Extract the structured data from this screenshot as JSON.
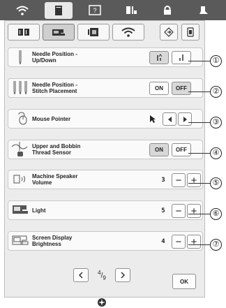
{
  "top_tabs": [
    {
      "name": "wifi-icon",
      "active": false
    },
    {
      "name": "page-icon",
      "active": true
    },
    {
      "name": "help-icon",
      "active": false
    },
    {
      "name": "stitch-icon",
      "active": false
    },
    {
      "name": "lock-icon",
      "active": false
    },
    {
      "name": "presser-foot-icon",
      "active": false
    }
  ],
  "sub_tabs": [
    {
      "name": "sewing-settings-icon",
      "active": false
    },
    {
      "name": "machine-settings-icon",
      "active": true
    },
    {
      "name": "embroidery-settings-icon",
      "active": false
    },
    {
      "name": "wireless-icon",
      "active": false
    }
  ],
  "rows": [
    {
      "label": "Needle Position -\nUp/Down",
      "icon": "needle-icon",
      "callout": "①"
    },
    {
      "label": "Needle Position -\nStitch Placement",
      "icon": "needles-icon",
      "on": "ON",
      "off": "OFF",
      "callout": "②"
    },
    {
      "label": "Mouse Pointer",
      "icon": "mouse-icon",
      "callout": "③"
    },
    {
      "label": "Upper and Bobbin\nThread Sensor",
      "icon": "thread-sensor-icon",
      "on": "ON",
      "off": "OFF",
      "callout": "④"
    },
    {
      "label": "Machine Speaker\nVolume",
      "icon": "speaker-icon",
      "value": "3",
      "callout": "⑤"
    },
    {
      "label": "Light",
      "icon": "light-icon",
      "value": "5",
      "callout": "⑥"
    },
    {
      "label": "Screen Display\nBrightness",
      "icon": "screen-icon",
      "value": "4",
      "callout": "⑦"
    }
  ],
  "minus": "−",
  "plus": "+",
  "pager": {
    "numerator": "4",
    "denominator": "9"
  },
  "ok_label": "OK"
}
